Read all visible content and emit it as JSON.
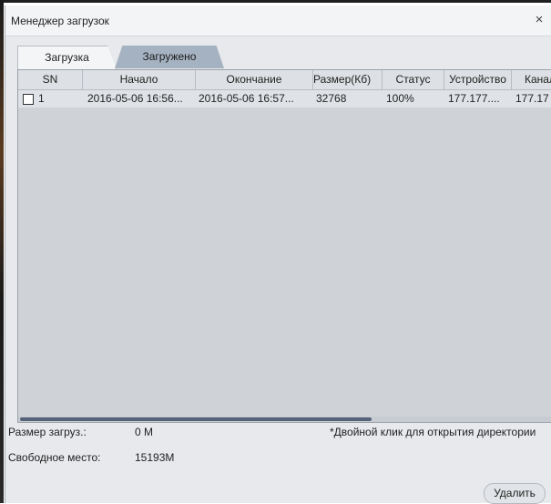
{
  "window": {
    "title": "Менеджер загрузок",
    "close_glyph": "×"
  },
  "tabs": [
    {
      "label": "Загрузка",
      "active": false
    },
    {
      "label": "Загружено",
      "active": true
    }
  ],
  "table": {
    "columns": [
      "SN",
      "Начало",
      "Окончание",
      "Размер(Кб)",
      "Статус",
      "Устройство",
      "Канал"
    ],
    "rows": [
      {
        "sn": "1",
        "start": "2016-05-06 16:56...",
        "end": "2016-05-06 16:57...",
        "size": "32768",
        "status": "100%",
        "device": "177.177....",
        "channel": "177.17",
        "checked": false
      }
    ]
  },
  "footer": {
    "download_size_label": "Размер загруз.:",
    "download_size_value": "0 M",
    "free_space_label": "Свободное место:",
    "free_space_value": "15193M",
    "hint": "*Двойной клик для открытия директории",
    "delete_label": "Удалить"
  },
  "colors": {
    "active_tab": "#a5b2c1",
    "grid_bg": "#cfd3d8",
    "scroll_thumb": "#56627a"
  }
}
